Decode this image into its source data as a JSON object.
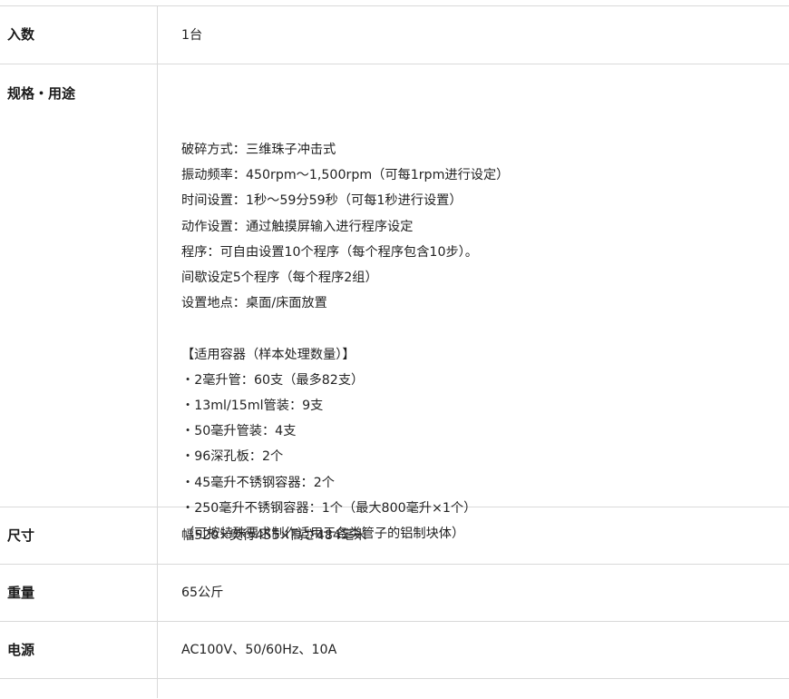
{
  "rows": [
    {
      "label": "入数",
      "lines": [
        "1台"
      ]
    },
    {
      "label": "规格・用途",
      "lines": [
        "破碎方式：三维珠子冲击式",
        "振动频率：450rpm～1,500rpm（可每1rpm进行设定）",
        "时间设置：1秒～59分59秒（可每1秒进行设置）",
        "动作设置：通过触摸屏输入进行程序设定",
        "程序：可自由设置10个程序（每个程序包含10步）。",
        "间歇设定5个程序（每个程序2组）",
        "设置地点：桌面/床面放置",
        "",
        "【适用容器（样本处理数量）】",
        "・2毫升管：60支（最多82支）",
        "・13ml/15ml管装：9支",
        "・50毫升管装：4支",
        "・96深孔板：2个",
        "・45毫升不锈钢容器：2个",
        "・250毫升不锈钢容器：1个（最大800毫升×1个）",
        "（可按特殊要求制作适用于各类管子的铝制块体）"
      ]
    },
    {
      "label": "尺寸",
      "lines": [
        "幅520×奥行455×高さ484毫米"
      ]
    },
    {
      "label": "重量",
      "lines": [
        "65公斤"
      ]
    },
    {
      "label": "电源",
      "lines": [
        "AC100V、50/60Hz、10A"
      ]
    }
  ]
}
